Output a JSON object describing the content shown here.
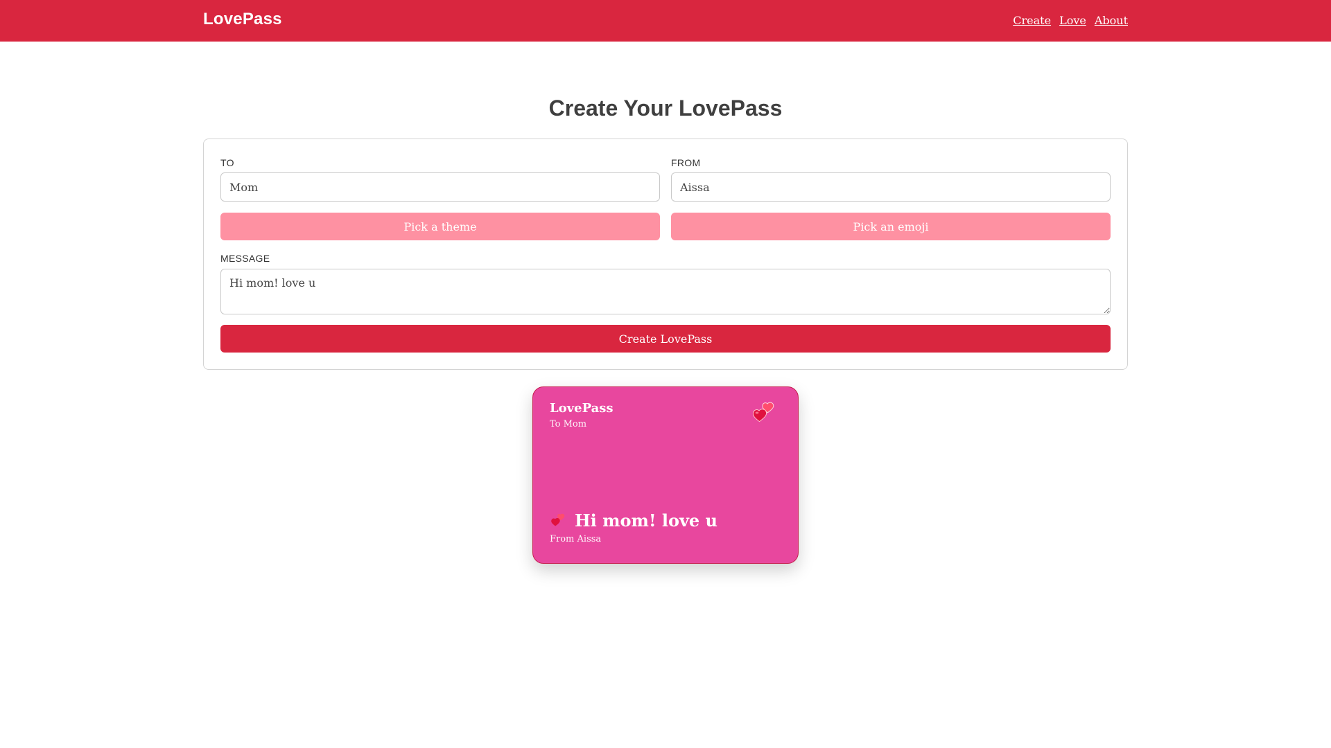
{
  "header": {
    "brand": "LovePass",
    "nav": [
      "Create",
      "Love",
      "About"
    ]
  },
  "page": {
    "title": "Create Your LovePass"
  },
  "form": {
    "to_label": "TO",
    "to_value": "Mom",
    "from_label": "FROM",
    "from_value": "Aissa",
    "theme_button": "Pick a theme",
    "emoji_button": "Pick an emoji",
    "message_label": "MESSAGE",
    "message_value": "Hi mom! love u",
    "create_button": "Create LovePass"
  },
  "preview": {
    "brand": "LovePass",
    "to_line": "To Mom",
    "message": "Hi mom! love u",
    "from_line": "From Aissa",
    "emoji_icon": "two-hearts-icon"
  },
  "colors": {
    "brand": "#d9263f",
    "soft": "#fe91a2",
    "card": "#e8479e"
  }
}
